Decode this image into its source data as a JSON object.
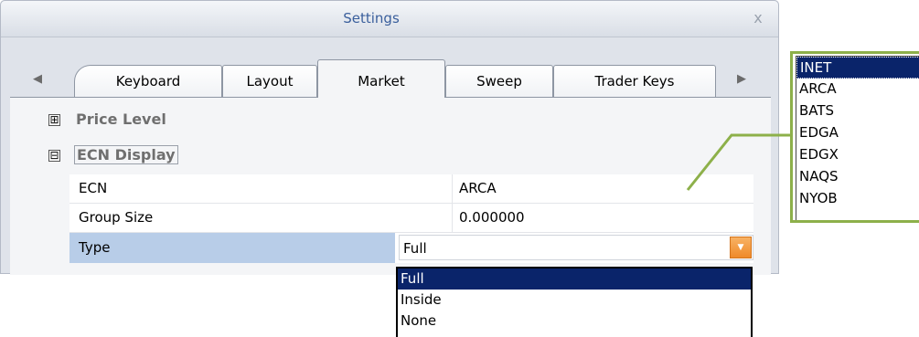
{
  "window": {
    "title": "Settings",
    "close_glyph": "x"
  },
  "tabs": [
    {
      "label": "Keyboard",
      "active": false
    },
    {
      "label": "Layout",
      "active": false
    },
    {
      "label": "Market",
      "active": true
    },
    {
      "label": "Sweep",
      "active": false
    },
    {
      "label": "Trader Keys",
      "active": false
    }
  ],
  "tab_scroll": {
    "left_icon": "triangle-left-icon",
    "right_icon": "triangle-right-icon",
    "left_glyph": "◀",
    "right_glyph": "▶"
  },
  "categories": [
    {
      "label": "Price Level",
      "expander": "⊞",
      "expanded": false
    },
    {
      "label": "ECN Display",
      "expander": "⊟",
      "expanded": true
    }
  ],
  "properties": [
    {
      "name": "ECN",
      "value": "ARCA"
    },
    {
      "name": "Group Size",
      "value": "0.000000"
    },
    {
      "name": "Type",
      "value": "Full"
    }
  ],
  "type_dropdown": {
    "options": [
      "Full",
      "Inside",
      "None"
    ],
    "selected": "Full"
  },
  "ecn_callout": {
    "options": [
      "INET",
      "ARCA",
      "BATS",
      "EDGA",
      "EDGX",
      "NAQS",
      "NYOB"
    ],
    "selected": "INET"
  },
  "colors": {
    "title_text": "#3a5f9c",
    "selected_row": "#b8cde8",
    "selection": "#0a246a",
    "combo_button": "#ef8a2a",
    "callout": "#8db04a"
  }
}
